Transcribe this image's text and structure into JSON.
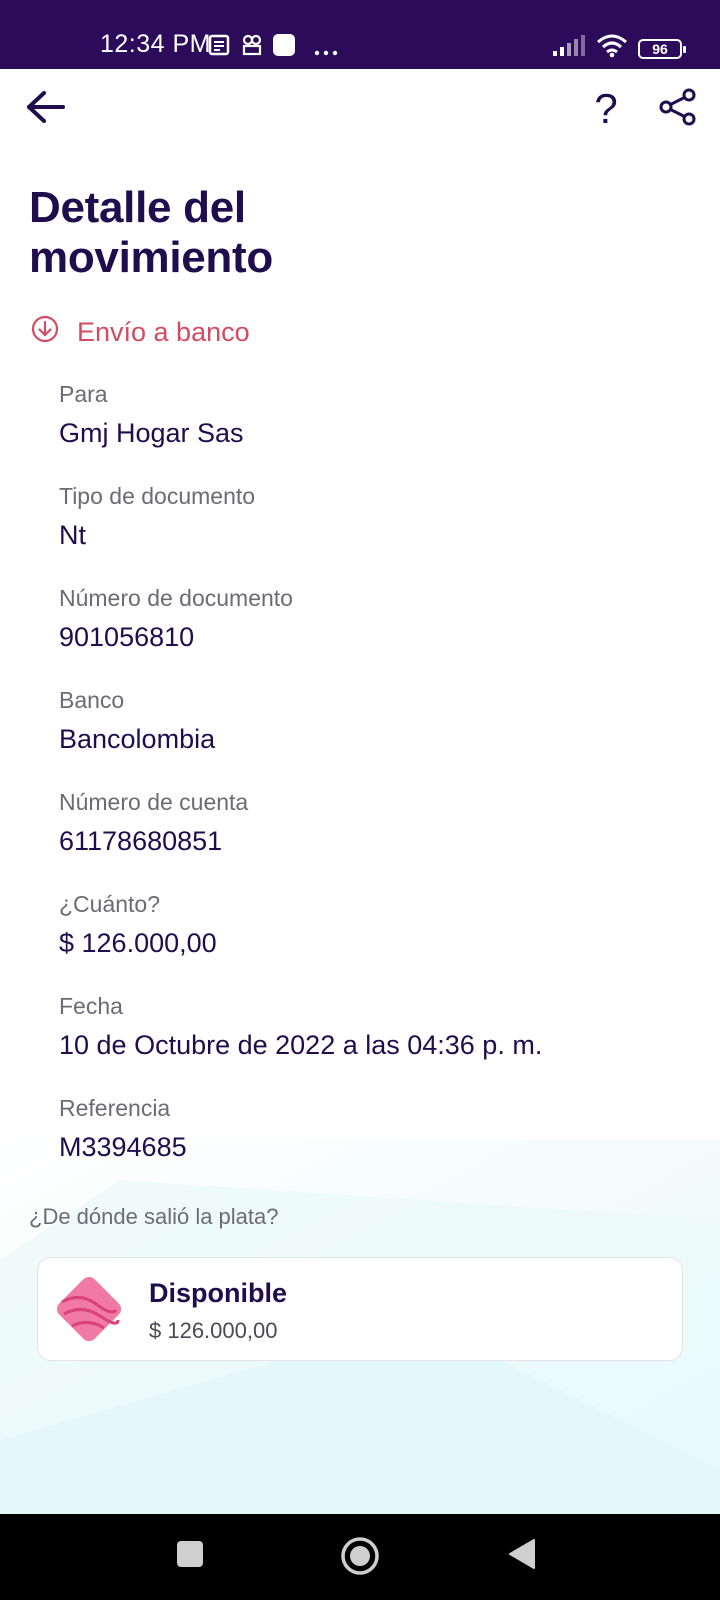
{
  "status_bar": {
    "time": "12:34 PM",
    "battery": "96",
    "icons": [
      "news-icon",
      "app-icon",
      "square-app-icon",
      "more-dots-icon",
      "signal-icon",
      "wifi-icon",
      "battery-icon"
    ]
  },
  "toolbar": {
    "back_icon": "arrow-left-icon",
    "help_label": "?",
    "share_icon": "share-icon"
  },
  "page": {
    "title_line1": "Detalle del",
    "title_line2": "movimiento",
    "movement_type": "Envío a banco",
    "movement_type_icon": "arrow-down-circle-icon",
    "accent_color": "#d54b63",
    "primary_color": "#200d4d"
  },
  "details": [
    {
      "label": "Para",
      "value": "Gmj Hogar Sas"
    },
    {
      "label": "Tipo de documento",
      "value": "Nt"
    },
    {
      "label": "Número de documento",
      "value": "901056810"
    },
    {
      "label": "Banco",
      "value": "Bancolombia"
    },
    {
      "label": "Número de cuenta",
      "value": "61178680851"
    },
    {
      "label": "¿Cuánto?",
      "value": "$ 126.000,00"
    },
    {
      "label": "Fecha",
      "value": "10 de Octubre de 2022 a las 04:36 p. m."
    },
    {
      "label": "Referencia",
      "value": "M3394685"
    }
  ],
  "source": {
    "heading": "¿De dónde salió la plata?",
    "name": "Disponible",
    "amount": "$ 126.000,00",
    "icon": "pink-pocket-icon"
  },
  "nav_bar": {
    "icons": [
      "recents-square-icon",
      "home-circle-icon",
      "back-triangle-icon"
    ]
  }
}
